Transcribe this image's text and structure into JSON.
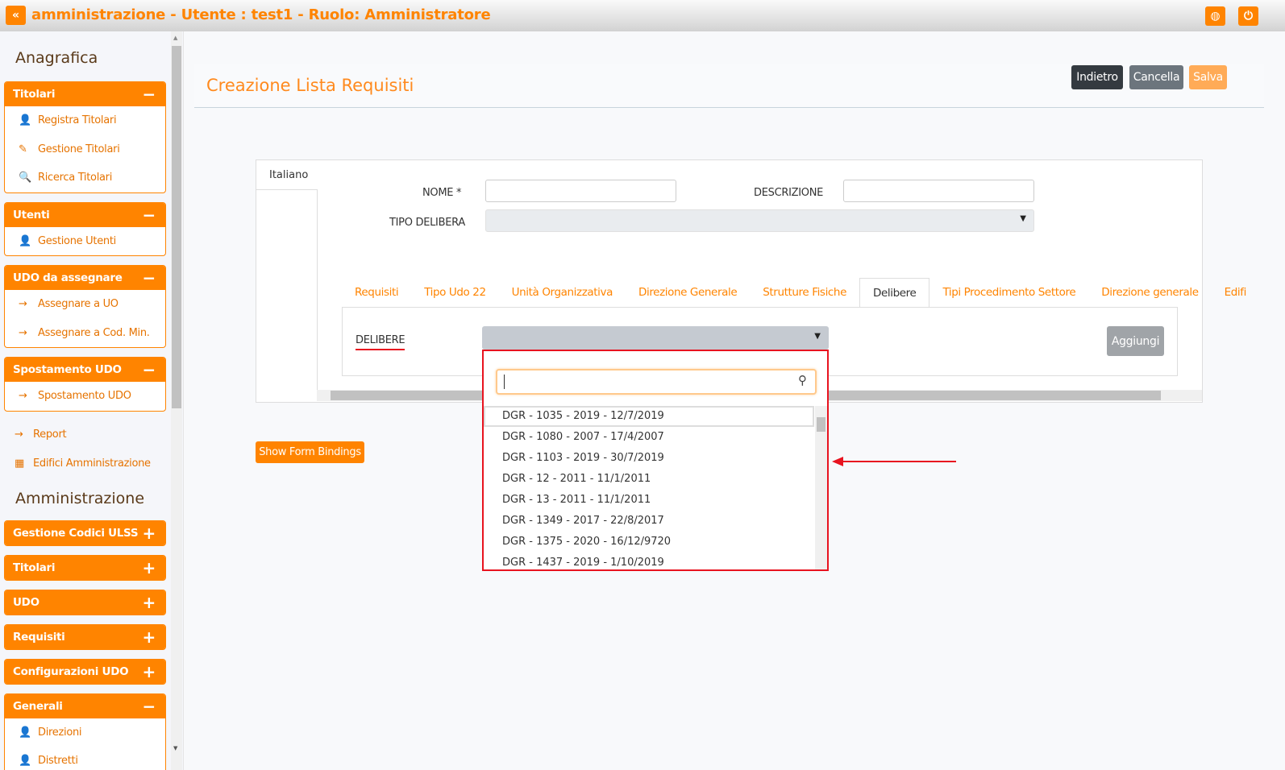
{
  "header": {
    "title": "amministrazione - Utente : test1 - Ruolo: Amministratore",
    "collapse_icon": "double-chevron-left-icon",
    "globe_icon": "globe-icon",
    "power_icon": "power-icon"
  },
  "sidebar": {
    "section1": "Anagrafica",
    "panels1": [
      {
        "title": "Titolari",
        "toggle": "−",
        "items": [
          {
            "label": "Registra Titolari",
            "icon": "user-edit-icon"
          },
          {
            "label": "Gestione Titolari",
            "icon": "edit-icon"
          },
          {
            "label": "Ricerca Titolari",
            "icon": "search-icon"
          }
        ]
      },
      {
        "title": "Utenti",
        "toggle": "−",
        "items": [
          {
            "label": "Gestione Utenti",
            "icon": "user-edit-icon"
          }
        ]
      },
      {
        "title": "UDO da assegnare",
        "toggle": "−",
        "items": [
          {
            "label": "Assegnare a UO",
            "icon": "arrow-right-icon"
          },
          {
            "label": "Assegnare a Cod. Min.",
            "icon": "arrow-right-icon"
          }
        ]
      },
      {
        "title": "Spostamento UDO",
        "toggle": "−",
        "items": [
          {
            "label": "Spostamento UDO",
            "icon": "arrow-right-icon"
          }
        ]
      }
    ],
    "links": [
      {
        "label": "Report",
        "icon": "arrow-right-icon"
      },
      {
        "label": "Edifici Amministrazione",
        "icon": "building-icon"
      }
    ],
    "section2": "Amministrazione",
    "panels2": [
      {
        "title": "Gestione Codici ULSS",
        "toggle": "+"
      },
      {
        "title": "Titolari",
        "toggle": "+"
      },
      {
        "title": "UDO",
        "toggle": "+"
      },
      {
        "title": "Requisiti",
        "toggle": "+"
      },
      {
        "title": "Configurazioni UDO",
        "toggle": "+"
      },
      {
        "title": "Generali",
        "toggle": "−",
        "items": [
          {
            "label": "Direzioni",
            "icon": "user-edit-icon"
          },
          {
            "label": "Distretti",
            "icon": "user-edit-icon"
          }
        ]
      }
    ]
  },
  "page": {
    "title": "Creazione Lista Requisiti",
    "buttons": {
      "back": "Indietro",
      "cancel": "Cancella",
      "save": "Salva"
    }
  },
  "form": {
    "lang_tab": "Italiano",
    "nome_label": "NOME *",
    "nome_value": "",
    "descr_label": "DESCRIZIONE",
    "descr_value": "",
    "tipo_label": "TIPO DELIBERA",
    "tipo_value": ""
  },
  "tabs": [
    "Requisiti",
    "Tipo Udo 22",
    "Unità Organizzativa",
    "Direzione Generale",
    "Strutture Fisiche",
    "Delibere",
    "Tipi Procedimento Settore",
    "Direzione generale",
    "Edifi"
  ],
  "active_tab": "Delibere",
  "delibere": {
    "label": "DELIBERE",
    "add": "Aggiungi",
    "search_value": "",
    "options": [
      "DGR - 1035 - 2019 - 12/7/2019",
      "DGR - 1080 - 2007 - 17/4/2007",
      "DGR - 1103 - 2019 - 30/7/2019",
      "DGR - 12 - 2011 - 11/1/2011",
      "DGR - 13 - 2011 - 11/1/2011",
      "DGR - 1349 - 2017 - 22/8/2017",
      "DGR - 1375 - 2020 - 16/12/9720",
      "DGR - 1437 - 2019 - 1/10/2019"
    ]
  },
  "show_bindings": "Show Form Bindings",
  "colors": {
    "accent": "#ff8400",
    "highlight": "#e8131f"
  }
}
